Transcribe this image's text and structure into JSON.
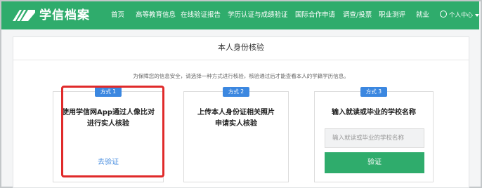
{
  "header": {
    "brand": "学信档案",
    "nav_items": [
      "首页",
      "高等教育信息",
      "在线验证报告",
      "学历认证与成绩验证",
      "国际合作申请",
      "调查/投票",
      "职业测评",
      "就业"
    ],
    "user_menu": "个人中心",
    "bg_color": "#2fac6c"
  },
  "panel": {
    "title": "本人身份核验",
    "notice": "为保障您的信息安全，请选择一种方式进行核验，核验通过后才能查看本人的学籍学历信息。"
  },
  "methods": [
    {
      "badge": "方式 1",
      "title_line1": "使用学信网App通过人像比对",
      "title_line2": "进行实人核验",
      "action": "去验证"
    },
    {
      "badge": "方式 2",
      "title_line1": "上传本人身份证相关照片",
      "title_line2": "申请实人核验"
    },
    {
      "badge": "方式 3",
      "title_line1": "输入就读或毕业的学校名称",
      "input_placeholder": "输入就读或毕业的学校名称",
      "button": "验证"
    }
  ],
  "colors": {
    "accent": "#2fac6c",
    "badge": "#3b87e0",
    "link": "#4a8fe0",
    "highlight": "#e02a2a"
  }
}
